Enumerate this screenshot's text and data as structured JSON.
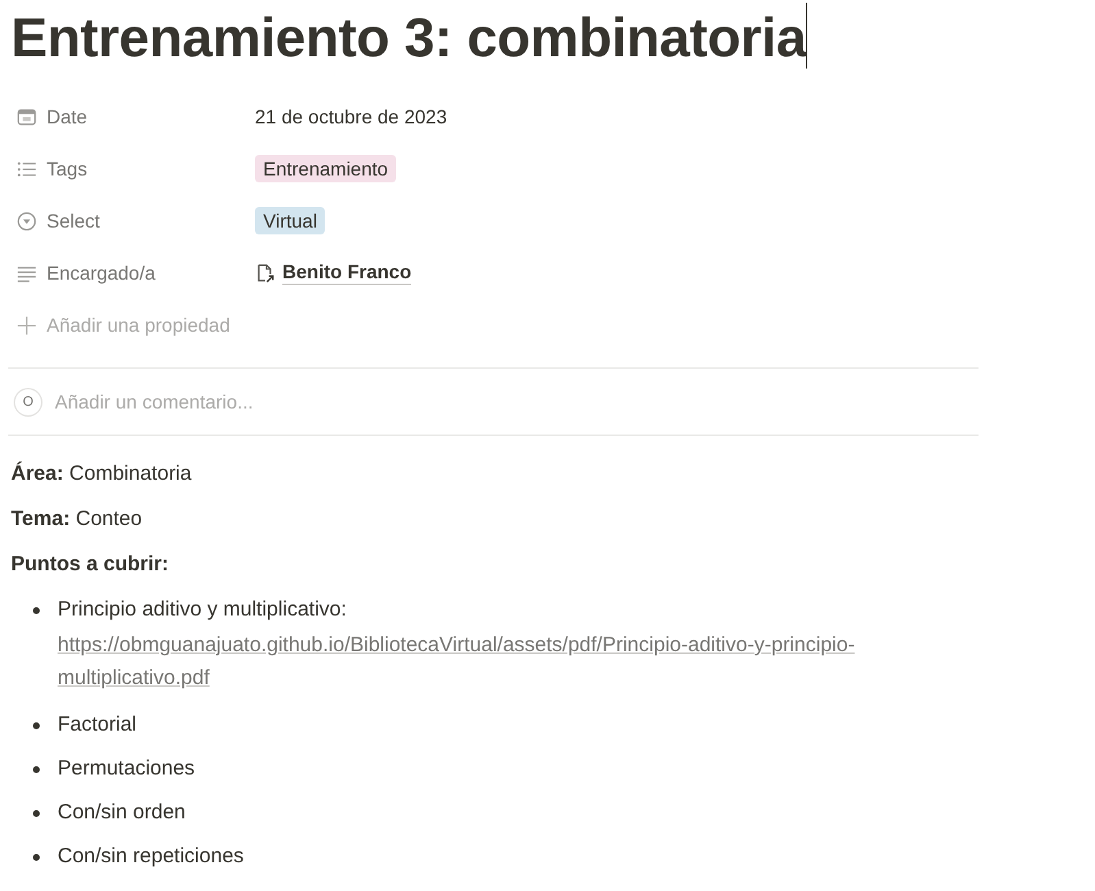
{
  "title": "Entrenamiento 3: combinatoria",
  "properties": [
    {
      "name": "Date",
      "kind": "text",
      "value": "21 de octubre de 2023"
    },
    {
      "name": "Tags",
      "kind": "tag",
      "value": "Entrenamiento",
      "color": "#f5e0e9"
    },
    {
      "name": "Select",
      "kind": "tag",
      "value": "Virtual",
      "color": "#d3e5ef"
    },
    {
      "name": "Encargado/a",
      "kind": "page",
      "value": "Benito Franco"
    }
  ],
  "add_property": "Añadir una propiedad",
  "comment": {
    "avatar": "O",
    "placeholder": "Añadir un comentario..."
  },
  "paragraphs": [
    "**Área:** Combinatoria",
    "**Tema:** Conteo",
    "**Puntos a cubrir:**"
  ],
  "bullets": [
    {
      "text": "Principio aditivo y multiplicativo:",
      "link": "https://obmguanajuato.github.io/BibliotecaVirtual/assets/pdf/Principio-aditivo-y-principio-multiplicativo.pdf"
    },
    {
      "text": "Factorial"
    },
    {
      "text": "Permutaciones"
    },
    {
      "text": "Con/sin orden"
    },
    {
      "text": "Con/sin repeticiones"
    }
  ]
}
